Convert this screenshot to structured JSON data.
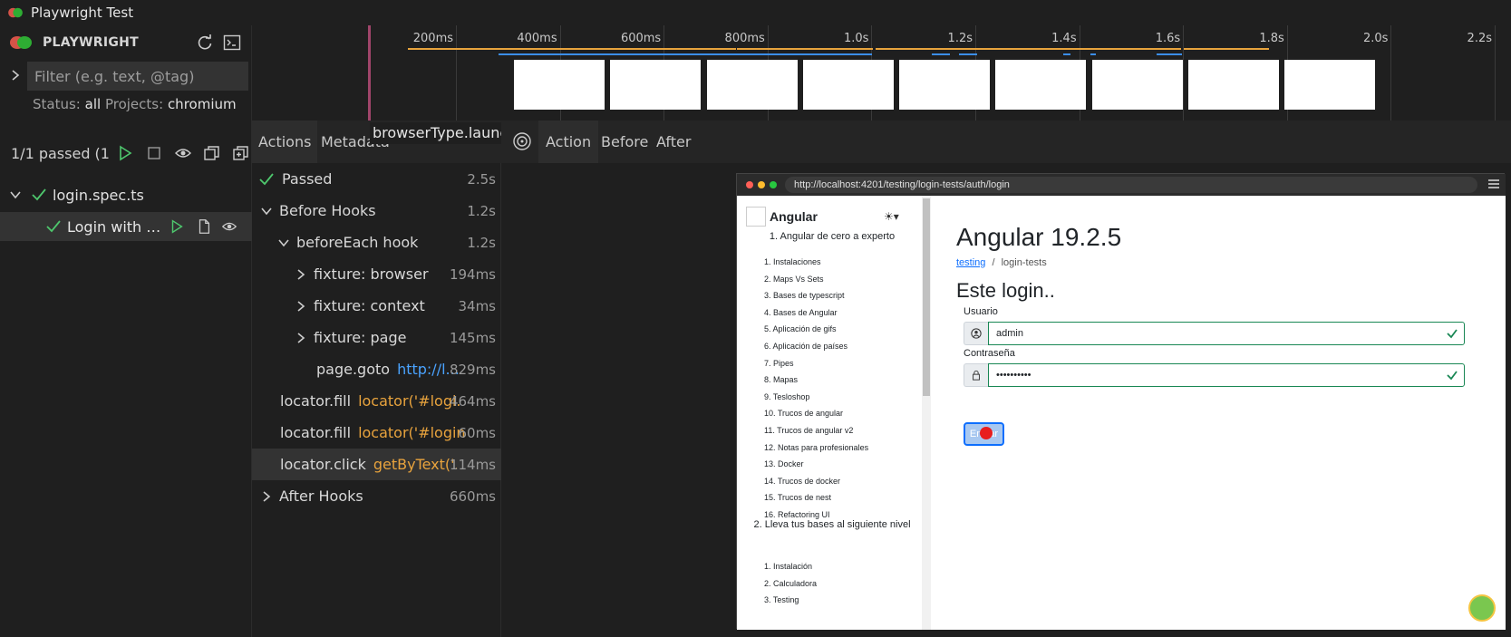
{
  "window": {
    "title": "Playwright Test"
  },
  "sidebar": {
    "brand": "PLAYWRIGHT",
    "filter_placeholder": "Filter (e.g. text, @tag)",
    "status_label": "Status:",
    "status_value": "all",
    "projects_label": "Projects:",
    "projects_value": "chromium",
    "summary": "1/1 passed (1...",
    "file": "login.spec.ts",
    "test": "Login with cr..."
  },
  "timeline": {
    "ticks": [
      "200ms",
      "400ms",
      "600ms",
      "800ms",
      "1.0s",
      "1.2s",
      "1.4s",
      "1.6s",
      "1.8s",
      "2.0s",
      "2.2s"
    ]
  },
  "actions": {
    "tabs": [
      "Actions",
      "Metadata"
    ],
    "tooltip": "browserType.launch",
    "rows": [
      {
        "name": "Passed",
        "duration": "2.5s"
      },
      {
        "name": "Before Hooks",
        "duration": "1.2s"
      },
      {
        "name": "beforeEach hook",
        "duration": "1.2s"
      },
      {
        "name": "fixture: browser",
        "duration": "194ms"
      },
      {
        "name": "fixture: context",
        "duration": "34ms"
      },
      {
        "name": "fixture: page",
        "duration": "145ms"
      },
      {
        "name": "page.goto",
        "arg": "http://l...",
        "duration": "829ms"
      },
      {
        "name": "locator.fill",
        "arg": "locator('#logi...",
        "duration": "464ms"
      },
      {
        "name": "locator.fill",
        "arg": "locator('#login...",
        "duration": "60ms"
      },
      {
        "name": "locator.click",
        "arg": "getByText('...",
        "duration": "114ms"
      },
      {
        "name": "After Hooks",
        "duration": "660ms"
      }
    ]
  },
  "snapshot": {
    "tabs": [
      "Action",
      "Before",
      "After"
    ],
    "url": "http://localhost:4201/testing/login-tests/auth/login"
  },
  "app": {
    "brand": "Angular",
    "theme_toggle": "☀▾",
    "section1": "1. Angular de cero a experto",
    "items1": [
      "1. Instalaciones",
      "2. Maps Vs Sets",
      "3. Bases de typescript",
      "4. Bases de Angular",
      "5. Aplicación de gifs",
      "6. Aplicación de países",
      "7. Pipes",
      "8. Mapas",
      "9. Tesloshop",
      "10. Trucos de angular",
      "11. Trucos de angular v2",
      "12. Notas para profesionales",
      "13. Docker",
      "14. Trucos de docker",
      "15. Trucos de nest",
      "16. Refactoring UI"
    ],
    "section2": "2. Lleva tus bases al siguiente nivel",
    "items2": [
      "1. Instalación",
      "2. Calculadora",
      "3. Testing"
    ],
    "title": "Angular 19.2.5",
    "breadcrumb_link": "testing",
    "breadcrumb_sep": "/",
    "breadcrumb_current": "login-tests",
    "heading": "Este login..",
    "user_label": "Usuario",
    "user_value": "admin",
    "pass_label": "Contraseña",
    "pass_value": "••••••••••",
    "button": "Enviar"
  },
  "colors": {
    "accent_green": "#4ec76d",
    "orange": "#e8a33d",
    "blue": "#3b8eea"
  }
}
